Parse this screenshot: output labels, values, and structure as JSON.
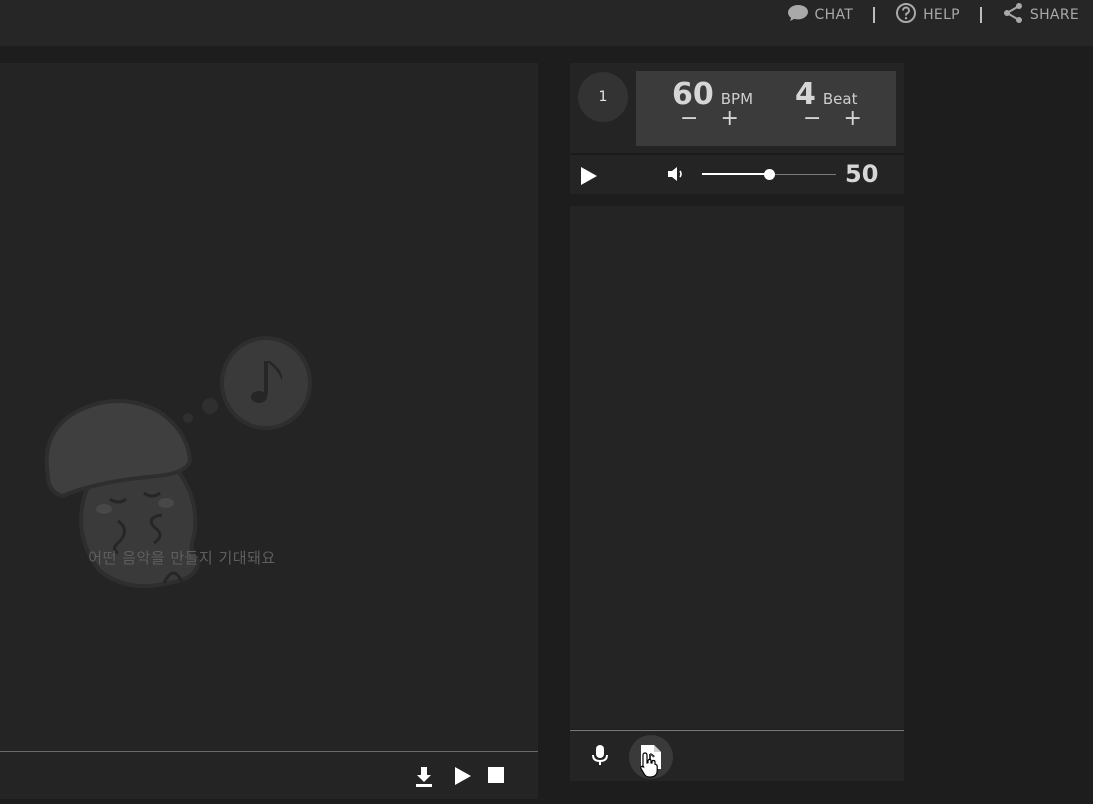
{
  "nav": {
    "chat": "CHAT",
    "help": "HELP",
    "share": "SHARE"
  },
  "canvas": {
    "empty_message": "어떤 음악을 만들지 기대돼요"
  },
  "transport": {
    "page_number": "1",
    "tempo": {
      "value": "60",
      "unit": "BPM",
      "minus": "−",
      "plus": "+"
    },
    "beat": {
      "value": "4",
      "unit": "Beat",
      "minus": "−",
      "plus": "+"
    },
    "volume": {
      "value": "50",
      "level_percent": 50
    }
  },
  "icons": {
    "chat": "chat-bubble-icon",
    "help": "help-circle-icon",
    "share": "share-icon",
    "download": "download-icon",
    "play": "play-icon",
    "stop": "stop-icon",
    "volume": "volume-icon",
    "mic": "microphone-icon",
    "file": "music-file-icon",
    "cursor": "hand-cursor-icon"
  },
  "colors": {
    "background": "#1d1d1d",
    "panel": "#242424",
    "tempo_box": "#3b3b3b",
    "text": "#d6d6d6",
    "muted_text": "#5e5e5e"
  }
}
